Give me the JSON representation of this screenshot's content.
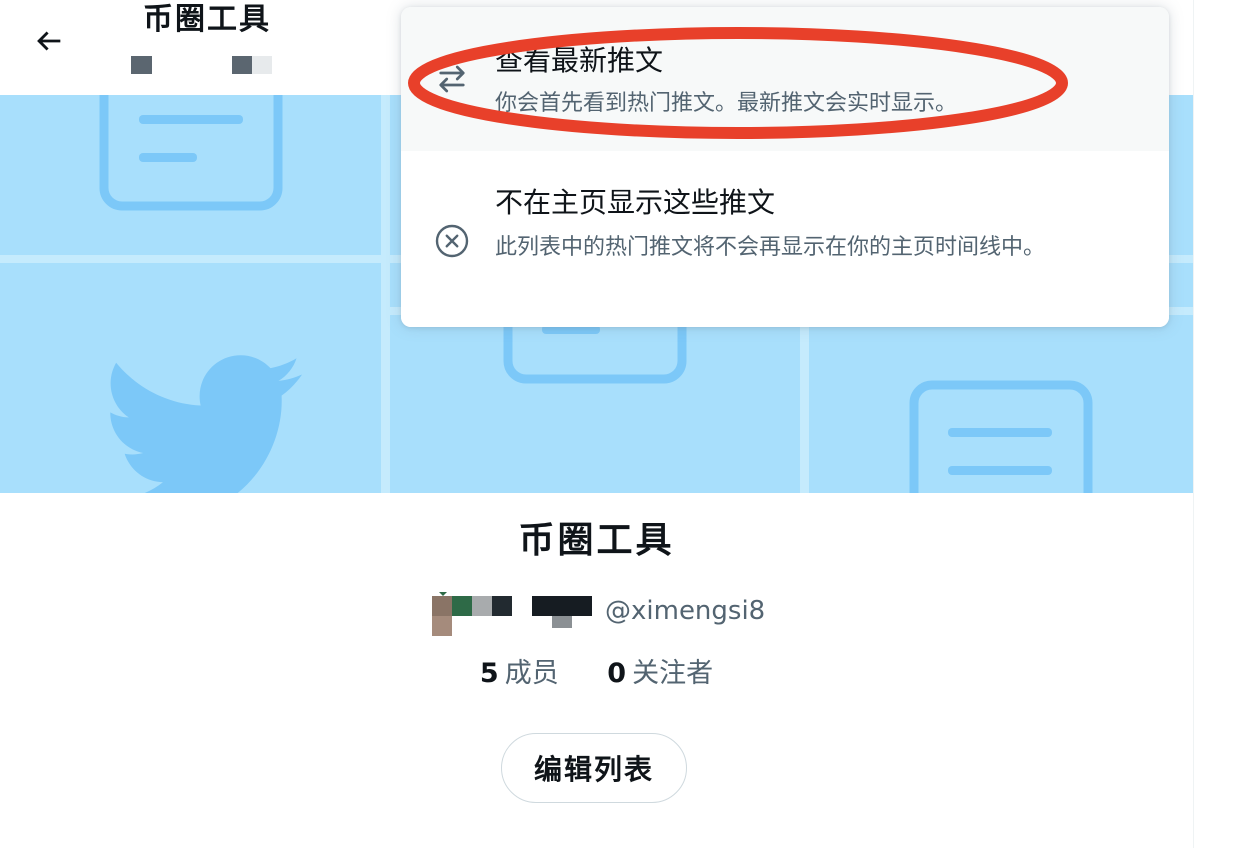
{
  "header": {
    "title": "币圈工具",
    "back_icon": "arrow-left-icon"
  },
  "dropdown": {
    "items": [
      {
        "title": "查看最新推文",
        "description": "你会首先看到热门推文。最新推文会实时显示。",
        "icon": "swap-arrows-icon"
      },
      {
        "title": "不在主页显示这些推文",
        "description": "此列表中的热门推文将不会再显示在你的主页时间线中。",
        "icon": "circle-x-icon"
      }
    ]
  },
  "list": {
    "name": "币圈工具",
    "owner_handle": "@ximengsi8",
    "members_count": "5",
    "members_label": "成员",
    "followers_count": "0",
    "followers_label": "关注者",
    "edit_label": "编辑列表"
  },
  "colors": {
    "banner": "#a8dffc",
    "banner_icons": "#7cc8f8",
    "annotation": "#e8402a",
    "secondary_text": "#536471"
  }
}
